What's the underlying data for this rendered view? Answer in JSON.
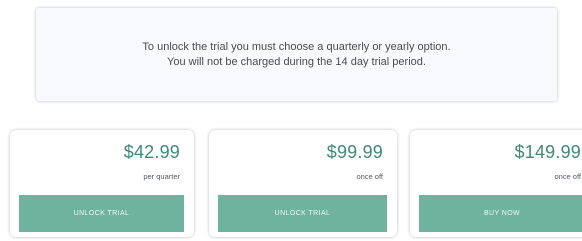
{
  "notice": {
    "line1": "To unlock the trial you must choose a quarterly or yearly option.",
    "line2": "You will not be charged during the 14 day trial period."
  },
  "plans": [
    {
      "price": "$42.99",
      "period": "per quarter",
      "button": "UNLOCK TRIAL"
    },
    {
      "price": "$99.99",
      "period": "once off",
      "button": "UNLOCK TRIAL"
    },
    {
      "price": "$149.99",
      "period": "once off",
      "button": "BUY NOW"
    }
  ],
  "colors": {
    "accent": "#6db39e",
    "price_text": "#3d8a78"
  }
}
